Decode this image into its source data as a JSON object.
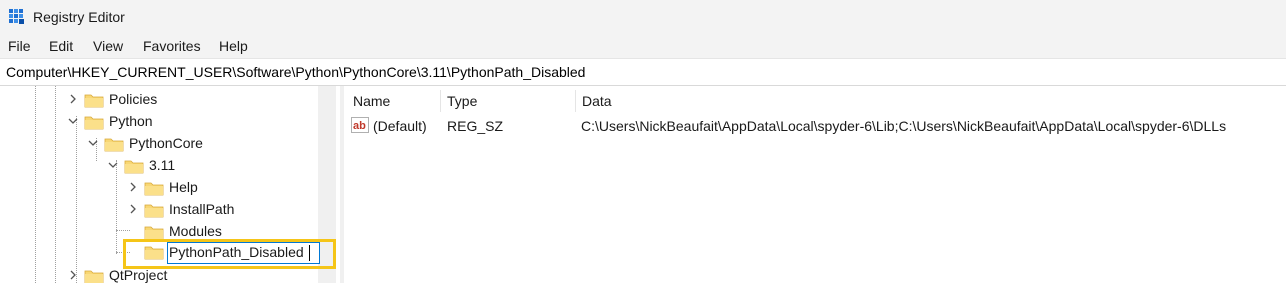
{
  "window": {
    "title": "Registry Editor"
  },
  "menu": [
    "File",
    "Edit",
    "View",
    "Favorites",
    "Help"
  ],
  "address": {
    "path": "Computer\\HKEY_CURRENT_USER\\Software\\Python\\PythonCore\\3.11\\PythonPath_Disabled"
  },
  "tree": {
    "nodes": [
      {
        "label": "Policies",
        "expander": "collapsed"
      },
      {
        "label": "Python",
        "expander": "expanded"
      },
      {
        "label": "PythonCore",
        "expander": "expanded"
      },
      {
        "label": "3.11",
        "expander": "expanded"
      },
      {
        "label": "Help",
        "expander": "collapsed"
      },
      {
        "label": "InstallPath",
        "expander": "collapsed"
      },
      {
        "label": "Modules",
        "expander": "none"
      },
      {
        "label": "PythonPath_Disabled",
        "expander": "none",
        "state": "renaming"
      },
      {
        "label": "QtProject",
        "expander": "collapsed"
      }
    ]
  },
  "values": {
    "columns": [
      "Name",
      "Type",
      "Data"
    ],
    "rows": [
      {
        "icon": "string-value-ab-icon",
        "name": "(Default)",
        "type": "REG_SZ",
        "data": "C:\\Users\\NickBeaufait\\AppData\\Local\\spyder-6\\Lib;C:\\Users\\NickBeaufait\\AppData\\Local\\spyder-6\\DLLs"
      }
    ]
  },
  "colors": {
    "highlight": "#f5c518",
    "folder": "#f8d775",
    "accent": "#0078d4"
  }
}
